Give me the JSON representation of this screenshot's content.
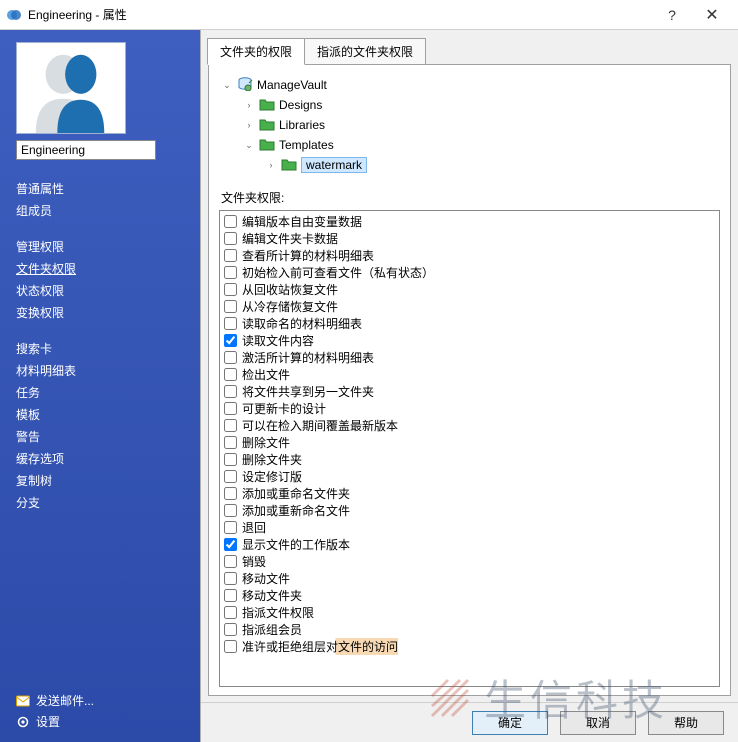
{
  "window": {
    "title": "Engineering - 属性",
    "help_glyph": "?",
    "close_glyph": "✕"
  },
  "sidebar": {
    "name_value": "Engineering",
    "groups": [
      {
        "items": [
          {
            "label": "普通属性",
            "active": false
          },
          {
            "label": "组成员",
            "active": false
          }
        ]
      },
      {
        "items": [
          {
            "label": "管理权限",
            "active": false
          },
          {
            "label": "文件夹权限",
            "active": true
          },
          {
            "label": "状态权限",
            "active": false
          },
          {
            "label": "变换权限",
            "active": false
          }
        ]
      },
      {
        "items": [
          {
            "label": "搜索卡",
            "active": false
          },
          {
            "label": "材料明细表",
            "active": false
          },
          {
            "label": "任务",
            "active": false
          },
          {
            "label": "模板",
            "active": false
          },
          {
            "label": "警告",
            "active": false
          },
          {
            "label": "缓存选项",
            "active": false
          },
          {
            "label": "复制树",
            "active": false
          },
          {
            "label": "分支",
            "active": false
          }
        ]
      }
    ],
    "bottom": {
      "mail": "发送邮件...",
      "settings": "设置"
    }
  },
  "tabs": [
    {
      "label": "文件夹的权限",
      "active": true
    },
    {
      "label": "指派的文件夹权限",
      "active": false
    }
  ],
  "tree": {
    "root": "ManageVault",
    "children": [
      {
        "label": "Designs"
      },
      {
        "label": "Libraries"
      },
      {
        "label": "Templates",
        "expanded": true,
        "children": [
          {
            "label": "watermark",
            "selected": true
          }
        ]
      }
    ]
  },
  "permissions": {
    "heading": "文件夹权限:",
    "items": [
      {
        "label": "编辑版本自由变量数据",
        "checked": false
      },
      {
        "label": "编辑文件夹卡数据",
        "checked": false
      },
      {
        "label": "查看所计算的材料明细表",
        "checked": false
      },
      {
        "label": "初始检入前可查看文件（私有状态）",
        "checked": false
      },
      {
        "label": "从回收站恢复文件",
        "checked": false
      },
      {
        "label": "从冷存储恢复文件",
        "checked": false
      },
      {
        "label": "读取命名的材料明细表",
        "checked": false
      },
      {
        "label": "读取文件内容",
        "checked": true
      },
      {
        "label": "激活所计算的材料明细表",
        "checked": false
      },
      {
        "label": "检出文件",
        "checked": false
      },
      {
        "label": "将文件共享到另一文件夹",
        "checked": false
      },
      {
        "label": "可更新卡的设计",
        "checked": false
      },
      {
        "label": "可以在检入期间覆盖最新版本",
        "checked": false
      },
      {
        "label": "删除文件",
        "checked": false
      },
      {
        "label": "删除文件夹",
        "checked": false
      },
      {
        "label": "设定修订版",
        "checked": false
      },
      {
        "label": "添加或重命名文件夹",
        "checked": false
      },
      {
        "label": "添加或重新命名文件",
        "checked": false
      },
      {
        "label": "退回",
        "checked": false
      },
      {
        "label": "显示文件的工作版本",
        "checked": true
      },
      {
        "label": "销毁",
        "checked": false
      },
      {
        "label": "移动文件",
        "checked": false
      },
      {
        "label": "移动文件夹",
        "checked": false
      },
      {
        "label": "指派文件权限",
        "checked": false
      },
      {
        "label": "指派组会员",
        "checked": false
      },
      {
        "label": "准许或拒绝组层对文件的访问",
        "checked": false
      }
    ]
  },
  "buttons": {
    "ok": "确定",
    "cancel": "取消",
    "help": "帮助"
  },
  "watermark": {
    "text": "生信科技"
  }
}
